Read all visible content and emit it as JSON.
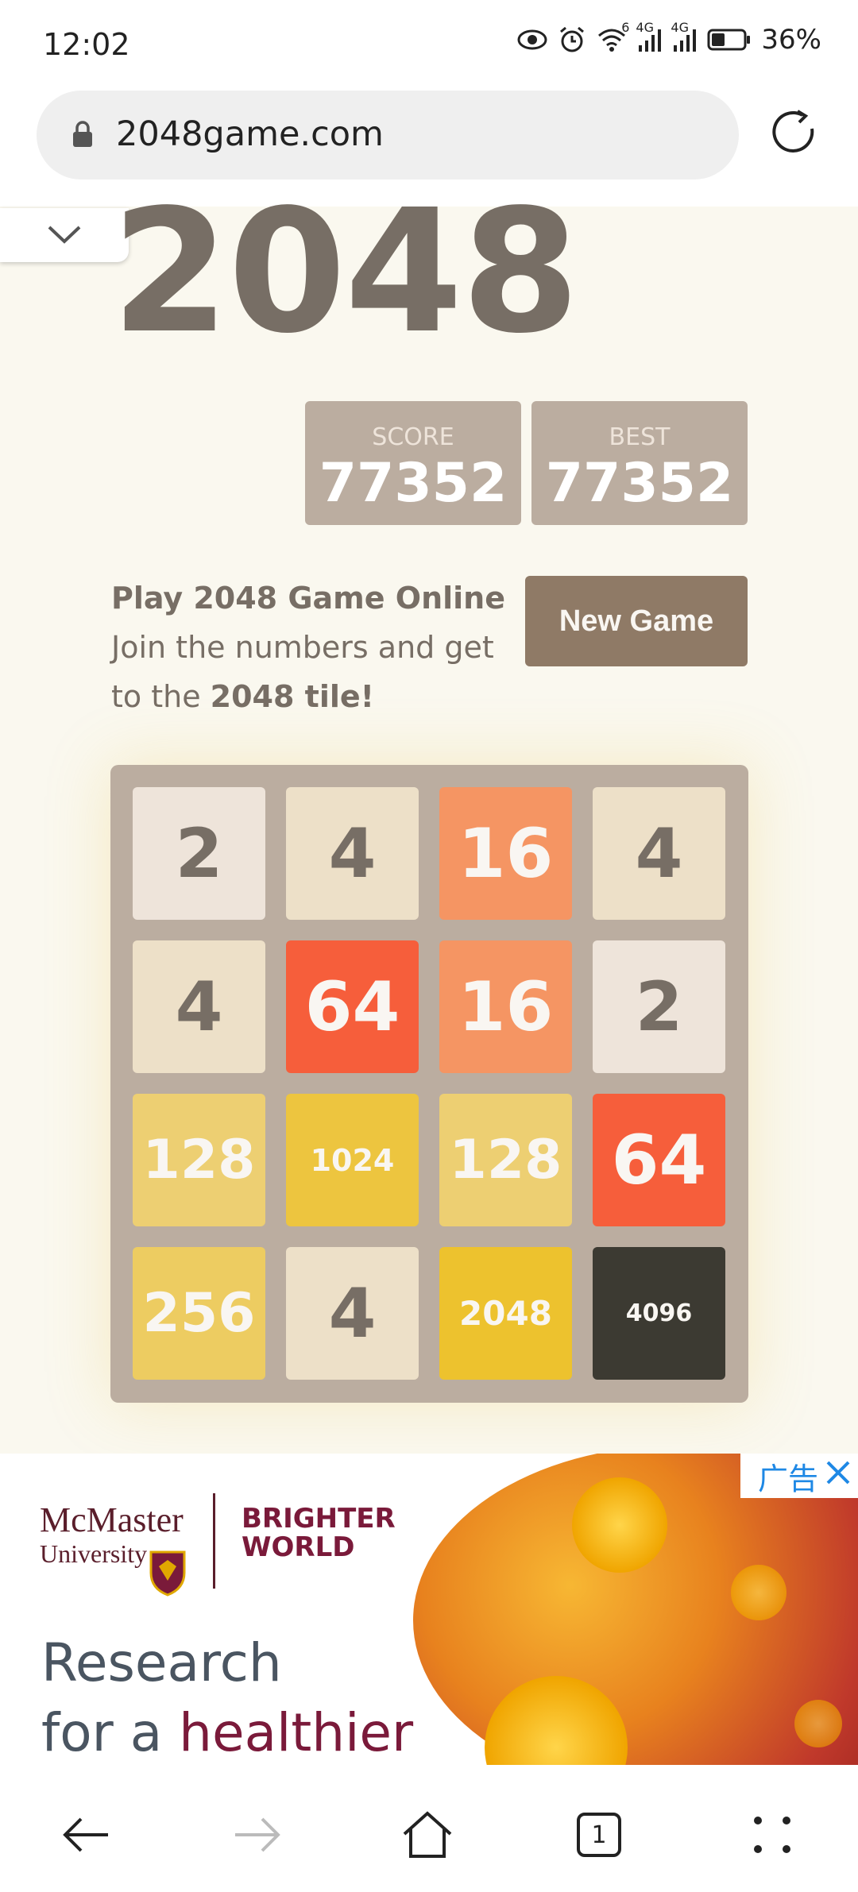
{
  "status_bar": {
    "time": "12:02",
    "battery": "36%",
    "network_4g_1": "4G",
    "network_4g_2": "4G",
    "wifi_badge": "6"
  },
  "browser": {
    "url": "2048game.com"
  },
  "game": {
    "title": "2048",
    "score_label": "SCORE",
    "score_value": "77352",
    "best_label": "BEST",
    "best_value": "77352",
    "intro_heading": "Play 2048 Game Online",
    "intro_line_prefix": "Join the numbers and get to the ",
    "intro_line_bold": "2048 tile!",
    "new_game_label": "New Game",
    "board": [
      [
        "2",
        "4",
        "16",
        "4"
      ],
      [
        "4",
        "64",
        "16",
        "2"
      ],
      [
        "128",
        "1024",
        "128",
        "64"
      ],
      [
        "256",
        "4",
        "2048",
        "4096"
      ]
    ],
    "tile_colors": {
      "2": {
        "bg": "#eee4da",
        "fg": "#776e65"
      },
      "4": {
        "bg": "#ede0c8",
        "fg": "#776e65"
      },
      "16": {
        "bg": "#f59563",
        "fg": "#f9f6f2"
      },
      "64": {
        "bg": "#f65e3b",
        "fg": "#f9f6f2"
      },
      "128": {
        "bg": "#edcf72",
        "fg": "#f9f6f2"
      },
      "256": {
        "bg": "#edcc61",
        "fg": "#f9f6f2"
      },
      "1024": {
        "bg": "#edc53f",
        "fg": "#f9f6f2"
      },
      "2048": {
        "bg": "#edc22e",
        "fg": "#f9f6f2"
      },
      "4096": {
        "bg": "#3c3a32",
        "fg": "#f9f6f2"
      }
    }
  },
  "ad": {
    "badge_label": "广告",
    "university_name": "McMaster",
    "university_suffix": "University",
    "tagline_line1": "BRIGHTER",
    "tagline_line2": "WORLD",
    "headline_line1": "Research",
    "headline_line2_prefix": "for a ",
    "headline_line2_accent": "healthier"
  },
  "bottom_nav": {
    "tab_count": "1"
  },
  "colors": {
    "page_bg": "#faf8ef",
    "grid_bg": "#bbada0",
    "button_bg": "#8f7a66",
    "title_text": "#776e65"
  }
}
